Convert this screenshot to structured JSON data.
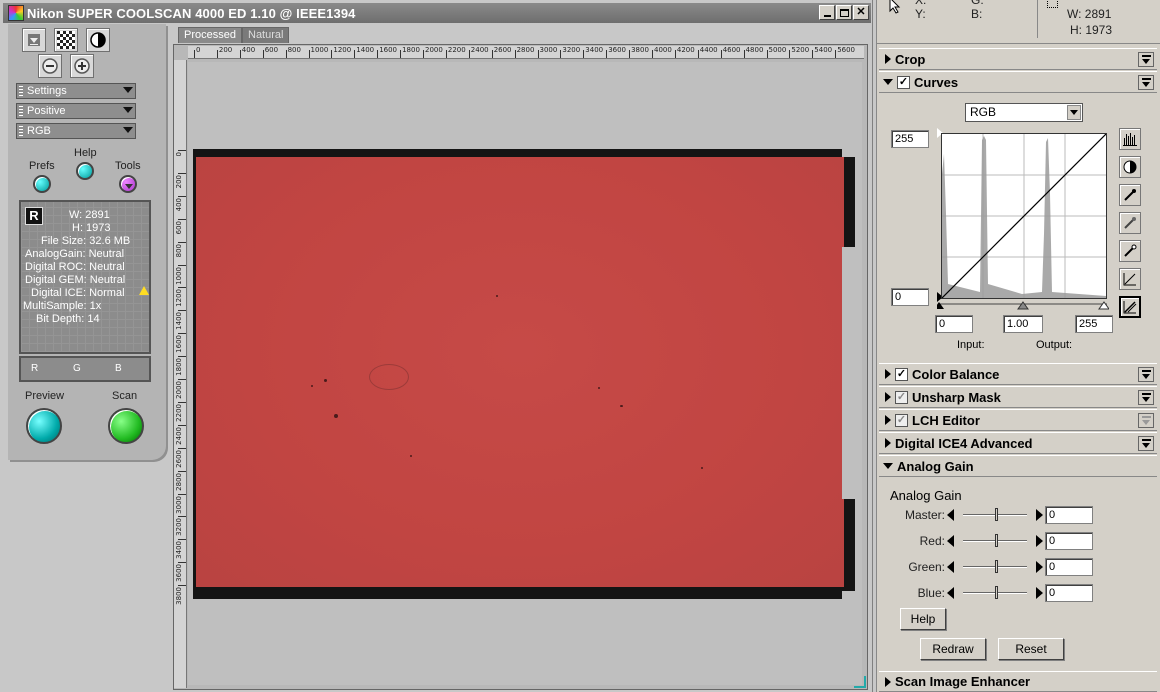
{
  "window": {
    "title": "Nikon SUPER COOLSCAN 4000 ED 1.10 @ IEEE1394"
  },
  "toolstrip": {
    "dropdowns": [
      "Settings",
      "Positive",
      "RGB"
    ],
    "prefs_label": "Prefs",
    "help_label": "Help",
    "tools_label": "Tools",
    "preview_label": "Preview",
    "scan_label": "Scan"
  },
  "info": {
    "badge": "R",
    "width": "W: 2891",
    "height": "H: 1973",
    "file_size": "File Size: 32.6 MB",
    "analog_gain": "AnalogGain: Neutral",
    "digital_roc": "Digital ROC: Neutral",
    "digital_gem": "Digital GEM: Neutral",
    "digital_ice": "Digital ICE: Normal",
    "multisample": "MultiSample: 1x",
    "bit_depth": "Bit Depth: 14",
    "channels": [
      "R",
      "G",
      "B"
    ]
  },
  "preview": {
    "tabs": [
      "Processed",
      "Natural"
    ],
    "ruler_top": [
      "0",
      "200",
      "400",
      "600",
      "800",
      "1000",
      "1200",
      "1400",
      "1600",
      "1800",
      "2000",
      "2200",
      "2400",
      "2600",
      "2800",
      "3000",
      "3200",
      "3400",
      "3600",
      "3800",
      "4000",
      "4200",
      "4400",
      "4600",
      "4800",
      "5000",
      "5200",
      "5400",
      "5600"
    ],
    "ruler_left": [
      "0",
      "200",
      "400",
      "600",
      "800",
      "1000",
      "1200",
      "1400",
      "1600",
      "1800",
      "2000",
      "2200",
      "2400",
      "2600",
      "2800",
      "3000",
      "3200",
      "3400",
      "3600",
      "3800"
    ],
    "film_color": "#c14542"
  },
  "coords": {
    "x_label": "X:",
    "y_label": "Y:",
    "g_label": "G:",
    "b_label": "B:",
    "w": "W:  2891",
    "h": "H:  1973"
  },
  "palette": {
    "crop": "Crop",
    "curves": "Curves",
    "color_balance": "Color Balance",
    "unsharp_mask": "Unsharp Mask",
    "lch_editor": "LCH Editor",
    "digital_ice4": "Digital ICE4 Advanced",
    "analog_gain": "Analog Gain",
    "scan_image_enhancer": "Scan Image Enhancer"
  },
  "curves": {
    "channel": "RGB",
    "output_max": "255",
    "output_min": "0",
    "input_black": "0",
    "gamma": "1.00",
    "input_white": "255",
    "input_label": "Input:",
    "output_label": "Output:"
  },
  "analog_gain": {
    "heading": "Analog Gain",
    "rows": [
      {
        "label": "Master:",
        "value": "0"
      },
      {
        "label": "Red:",
        "value": "0"
      },
      {
        "label": "Green:",
        "value": "0"
      },
      {
        "label": "Blue:",
        "value": "0"
      }
    ],
    "help_button": "Help",
    "redraw_button": "Redraw",
    "reset_button": "Reset"
  }
}
